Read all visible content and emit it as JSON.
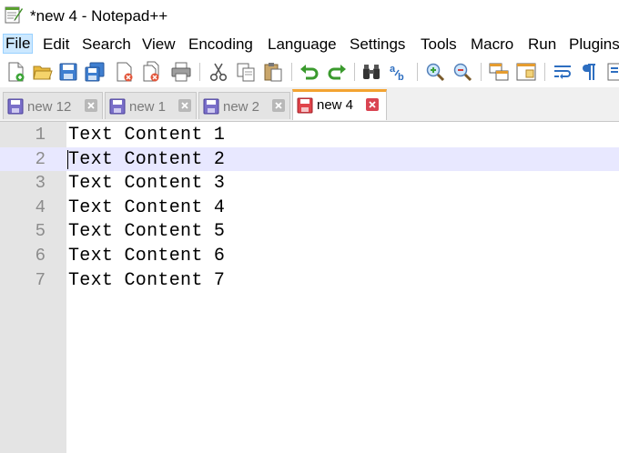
{
  "window": {
    "title": "*new 4 - Notepad++"
  },
  "menu": {
    "items": [
      {
        "label": "File",
        "active": true
      },
      {
        "label": "Edit"
      },
      {
        "label": "Search"
      },
      {
        "label": "View"
      },
      {
        "label": "Encoding"
      },
      {
        "label": "Language"
      },
      {
        "label": "Settings"
      },
      {
        "label": "Tools"
      },
      {
        "label": "Macro"
      },
      {
        "label": "Run"
      },
      {
        "label": "Plugins"
      }
    ]
  },
  "toolbar": {
    "icons": [
      "new-file-icon",
      "open-file-icon",
      "save-icon",
      "save-all-icon",
      "close-icon",
      "close-all-icon",
      "print-icon",
      "cut-icon",
      "copy-icon",
      "paste-icon",
      "undo-icon",
      "redo-icon",
      "find-icon",
      "replace-icon",
      "zoom-in-icon",
      "zoom-out-icon",
      "sync-vertical-icon",
      "sync-horizontal-icon",
      "word-wrap-icon",
      "show-all-chars-icon"
    ]
  },
  "tabs": [
    {
      "label": "new 12",
      "active": false
    },
    {
      "label": "new 1",
      "active": false
    },
    {
      "label": "new 2",
      "active": false
    },
    {
      "label": "new 4",
      "active": true,
      "modified": true
    }
  ],
  "editor": {
    "current_line": 2,
    "lines": [
      {
        "num": "1",
        "text": "Text Content 1"
      },
      {
        "num": "2",
        "text": "Text Content 2"
      },
      {
        "num": "3",
        "text": "Text Content 3"
      },
      {
        "num": "4",
        "text": "Text Content 4"
      },
      {
        "num": "5",
        "text": "Text Content 5"
      },
      {
        "num": "6",
        "text": "Text Content 6"
      },
      {
        "num": "7",
        "text": "Text Content 7"
      }
    ]
  },
  "colors": {
    "accent_tab": "#f3a331",
    "current_line": "#e8e8ff",
    "gutter": "#e4e4e4",
    "disk_blue": "#7a6fc9",
    "disk_red": "#e0444a"
  }
}
